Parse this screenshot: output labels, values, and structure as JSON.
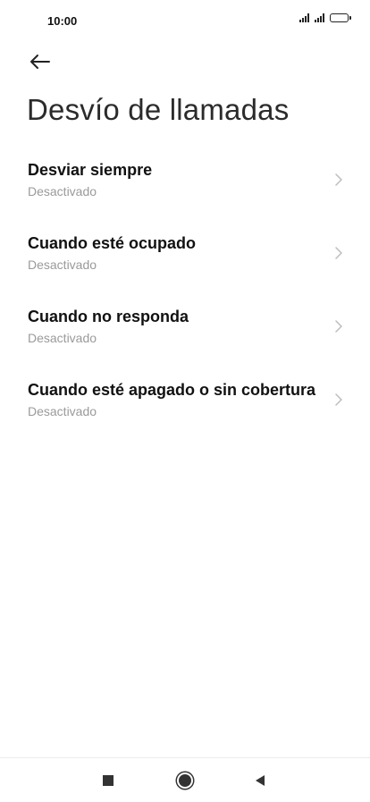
{
  "status_bar": {
    "time": "10:00"
  },
  "header": {
    "back_icon": "arrow-left-icon",
    "title": "Desvío de llamadas"
  },
  "items": [
    {
      "title": "Desviar siempre",
      "subtitle": "Desactivado"
    },
    {
      "title": "Cuando esté ocupado",
      "subtitle": "Desactivado"
    },
    {
      "title": "Cuando no responda",
      "subtitle": "Desactivado"
    },
    {
      "title": "Cuando esté apagado o sin cobertura",
      "subtitle": "Desactivado"
    }
  ],
  "nav": {
    "recents_icon": "square-icon",
    "home_icon": "circle-icon",
    "back_icon": "triangle-back-icon"
  },
  "colors": {
    "title_text": "#111111",
    "subtitle_text": "#9a9a9a",
    "chevron": "#bdbdbd"
  }
}
